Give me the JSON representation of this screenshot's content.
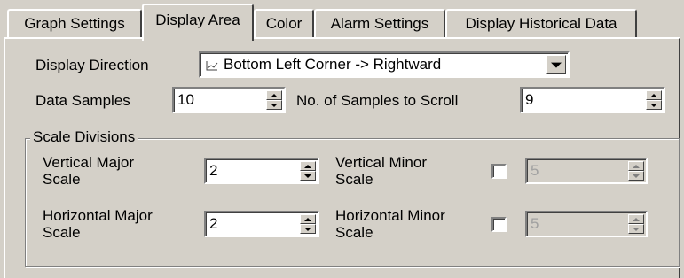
{
  "tabs": [
    {
      "label": "Graph Settings",
      "active": false
    },
    {
      "label": "Display Area",
      "active": true
    },
    {
      "label": "Color",
      "active": false
    },
    {
      "label": "Alarm Settings",
      "active": false
    },
    {
      "label": "Display Historical Data",
      "active": false
    }
  ],
  "display_direction": {
    "label": "Display Direction",
    "icon": "line-graph-icon",
    "selected": "Bottom Left Corner -> Rightward"
  },
  "data_samples": {
    "label": "Data Samples",
    "value": "10"
  },
  "samples_to_scroll": {
    "label": "No. of Samples to Scroll",
    "value": "9"
  },
  "scale_divisions": {
    "title": "Scale Divisions",
    "vertical_major": {
      "label": "Vertical Major Scale",
      "value": "2"
    },
    "vertical_minor": {
      "label": "Vertical Minor Scale",
      "checked": false,
      "value": "5",
      "enabled": false
    },
    "horizontal_major": {
      "label": "Horizontal Major Scale",
      "value": "2"
    },
    "horizontal_minor": {
      "label": "Horizontal Minor Scale",
      "checked": false,
      "value": "5",
      "enabled": false
    }
  }
}
